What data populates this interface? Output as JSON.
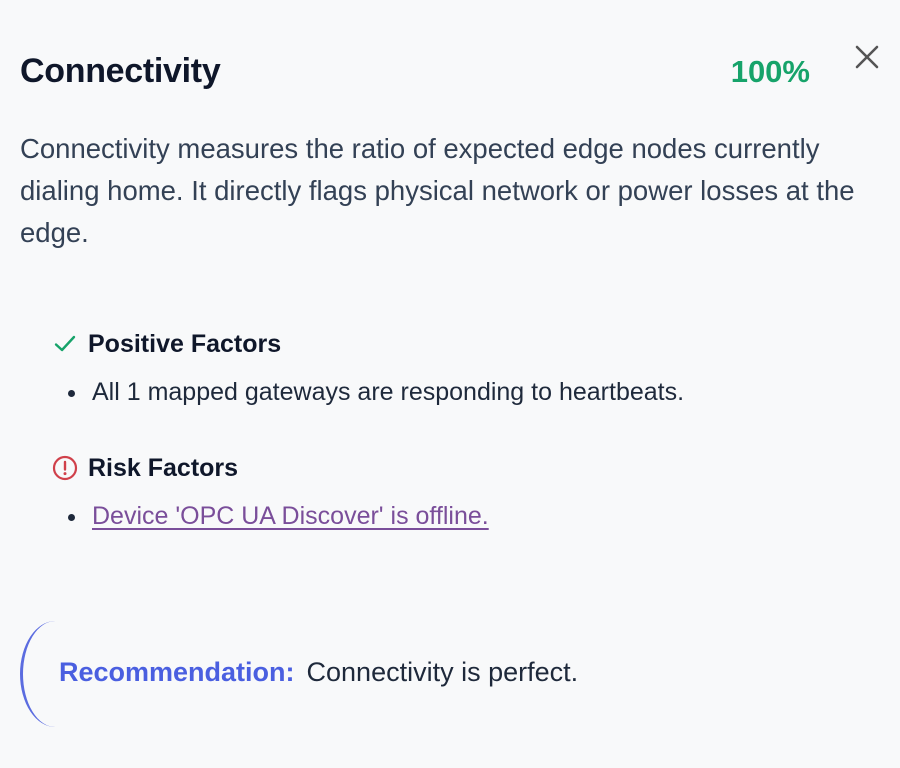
{
  "header": {
    "title": "Connectivity",
    "score": "100%"
  },
  "description": "Connectivity measures the ratio of expected edge nodes currently dialing home. It directly flags physical network or power losses at the edge.",
  "positive": {
    "title": "Positive Factors",
    "icon": "check-icon",
    "color": "#16a36a",
    "items": [
      "All 1 mapped gateways are responding to heartbeats."
    ]
  },
  "risk": {
    "title": "Risk Factors",
    "icon": "alert-circle-icon",
    "color": "#d0404a",
    "items": [
      "Device 'OPC UA Discover' is offline."
    ]
  },
  "recommendation": {
    "label": "Recommendation:",
    "text": "Connectivity is perfect."
  },
  "colors": {
    "accent": "#4a5fe0",
    "success": "#16a36a",
    "danger": "#d0404a",
    "link": "#7a4e9a"
  }
}
